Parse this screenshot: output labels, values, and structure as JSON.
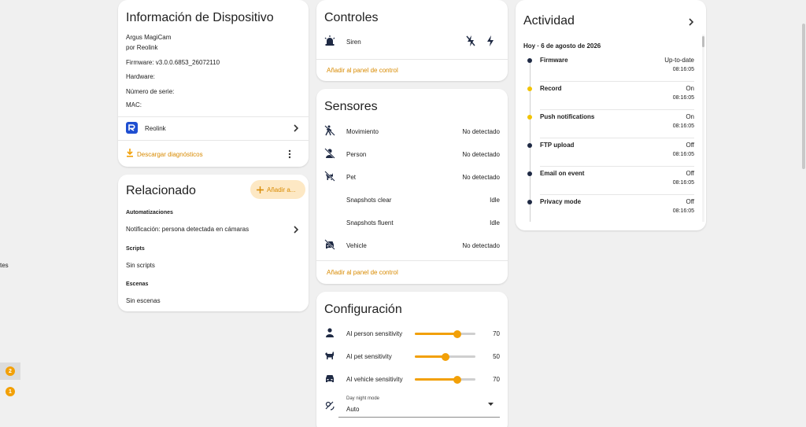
{
  "rail": {
    "partial_label": "tes",
    "badge_a": "2",
    "badge_b": "1"
  },
  "device_info": {
    "title": "Información de Dispositivo",
    "model": "Argus MagiCam",
    "maker": "por Reolink",
    "firmware": "Firmware: v3.0.0.6853_26072110",
    "hardware": "Hardware:",
    "serial": "Número de serie:",
    "mac": "MAC:",
    "integration": "Reolink",
    "download": "Descargar diagnósticos"
  },
  "related": {
    "title": "Relacionado",
    "add_button": "Añadir a...",
    "automations_heading": "Automatizaciones",
    "automation_item": "Notificación: persona detectada en cámaras",
    "scripts_heading": "Scripts",
    "scripts_empty": "Sin scripts",
    "scenes_heading": "Escenas",
    "scenes_empty": "Sin escenas"
  },
  "controls": {
    "title": "Controles",
    "siren_label": "Siren",
    "add_panel": "Añadir al panel de control"
  },
  "sensors": {
    "title": "Sensores",
    "items": [
      {
        "label": "Movimiento",
        "value": "No detectado"
      },
      {
        "label": "Person",
        "value": "No detectado"
      },
      {
        "label": "Pet",
        "value": "No detectado"
      },
      {
        "label": "Snapshots clear",
        "value": "Idle"
      },
      {
        "label": "Snapshots fluent",
        "value": "Idle"
      },
      {
        "label": "Vehicle",
        "value": "No detectado"
      }
    ],
    "add_panel": "Añadir al panel de control"
  },
  "config": {
    "title": "Configuración",
    "sliders": [
      {
        "label": "AI person sensitivity",
        "value": "70",
        "level": 70
      },
      {
        "label": "AI pet sensitivity",
        "value": "50",
        "level": 50
      },
      {
        "label": "AI vehicle sensitivity",
        "value": "70",
        "level": 70
      }
    ],
    "select_label": "Day night mode",
    "select_value": "Auto"
  },
  "activity": {
    "title": "Actividad",
    "date": "Hoy · 6 de agosto de 2026",
    "items": [
      {
        "name": "Firmware",
        "state": "Up-to-date",
        "time": "08:16:05",
        "color": "#1f2a44"
      },
      {
        "name": "Record",
        "state": "On",
        "time": "08:16:05",
        "color": "#f2c300"
      },
      {
        "name": "Push notifications",
        "state": "On",
        "time": "08:16:05",
        "color": "#f2c300"
      },
      {
        "name": "FTP upload",
        "state": "Off",
        "time": "08:16:05",
        "color": "#1f2a44"
      },
      {
        "name": "Email on event",
        "state": "Off",
        "time": "08:16:05",
        "color": "#1f2a44"
      },
      {
        "name": "Privacy mode",
        "state": "Off",
        "time": "08:16:05",
        "color": "#1f2a44"
      }
    ]
  },
  "colors": {
    "accent": "#f2a007",
    "link": "#d88a00",
    "brand_blue": "#1f4fd1"
  }
}
